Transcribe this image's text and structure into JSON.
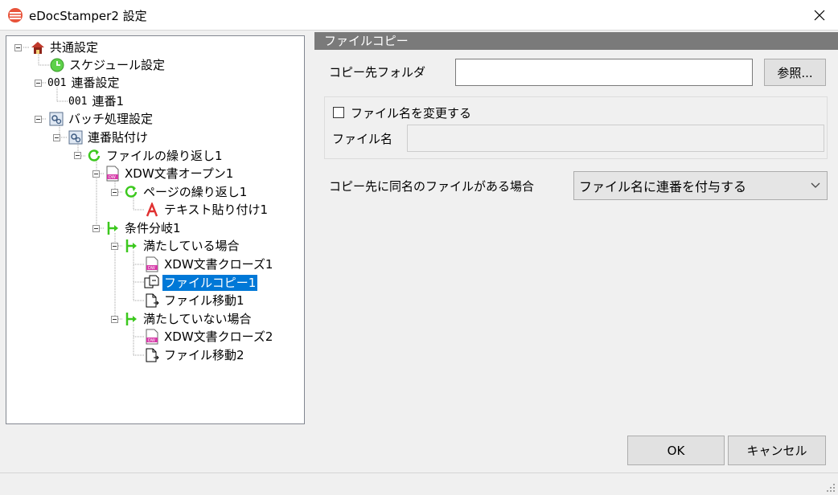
{
  "window": {
    "title": "eDocStamper2 設定",
    "close_icon": "close-icon"
  },
  "tree": {
    "nodes": [
      {
        "label": "共通設定",
        "icon": "house-icon"
      },
      {
        "label": "スケジュール設定",
        "icon": "clock-icon"
      },
      {
        "label": "連番設定",
        "icon": "number-icon",
        "prefix": "001"
      },
      {
        "label": "連番1",
        "icon": "number-icon",
        "prefix": "001"
      },
      {
        "label": "バッチ処理設定",
        "icon": "batch-icon"
      },
      {
        "label": "連番貼付け",
        "icon": "batch-icon"
      },
      {
        "label": "ファイルの繰り返し1",
        "icon": "loop-icon"
      },
      {
        "label": "XDW文書オープン1",
        "icon": "xdw-document-icon"
      },
      {
        "label": "ページの繰り返し1",
        "icon": "loop-icon"
      },
      {
        "label": "テキスト貼り付け1",
        "icon": "text-stamp-icon"
      },
      {
        "label": "条件分岐1",
        "icon": "branch-icon"
      },
      {
        "label": "満たしている場合",
        "icon": "branch-icon"
      },
      {
        "label": "XDW文書クローズ1",
        "icon": "xdw-document-icon"
      },
      {
        "label": "ファイルコピー1",
        "icon": "file-copy-icon",
        "selected": true
      },
      {
        "label": "ファイル移動1",
        "icon": "file-move-icon"
      },
      {
        "label": "満たしていない場合",
        "icon": "branch-icon"
      },
      {
        "label": "XDW文書クローズ2",
        "icon": "xdw-document-icon"
      },
      {
        "label": "ファイル移動2",
        "icon": "file-move-icon"
      }
    ]
  },
  "panel": {
    "header": "ファイルコピー",
    "dest_folder_label": "コピー先フォルダ",
    "dest_folder_value": "",
    "browse_button": "参照...",
    "rename_checkbox_label": "ファイル名を変更する",
    "rename_checked": false,
    "filename_label": "ファイル名",
    "filename_value": "",
    "conflict_label": "コピー先に同名のファイルがある場合",
    "conflict_selected": "ファイル名に連番を付与する"
  },
  "footer": {
    "ok_button": "OK",
    "cancel_button": "キャンセル"
  },
  "colors": {
    "selection": "#0078d7",
    "panel_header": "#7a7a7a",
    "green_icon": "#3cc81e"
  }
}
